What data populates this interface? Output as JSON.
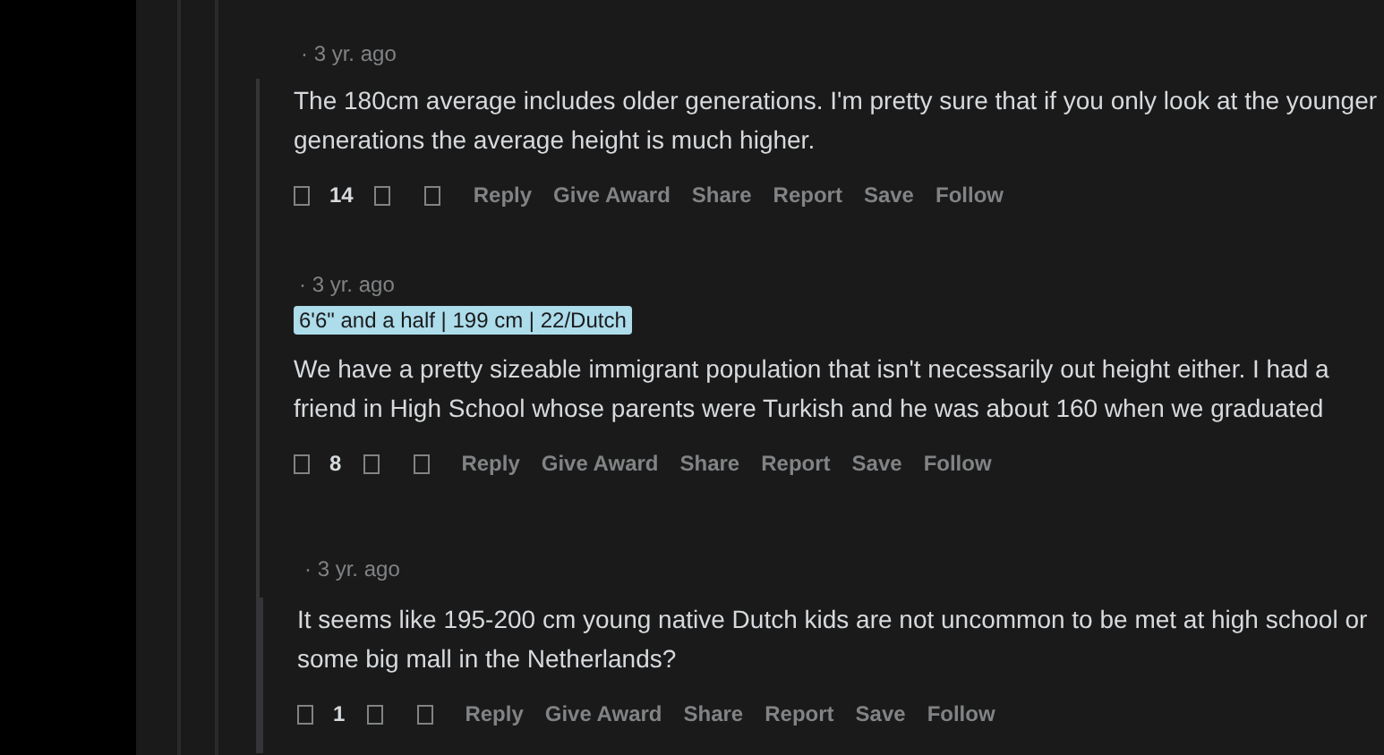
{
  "comments": [
    {
      "time": "· 3 yr. ago",
      "body": "The 180cm average includes older generations. I'm pretty sure that if you only look at the younger generations the average height is much higher.",
      "score": "14",
      "actions": [
        "Reply",
        "Give Award",
        "Share",
        "Report",
        "Save",
        "Follow"
      ],
      "children": [
        {
          "time": "· 3 yr. ago",
          "flair": "6'6\" and a half | 199 cm | 22/Dutch",
          "body": "We have a pretty sizeable immigrant population that isn't necessarily out height either. I had a friend in High School whose parents were Turkish and he was about 160 when we graduated",
          "score": "8",
          "actions": [
            "Reply",
            "Give Award",
            "Share",
            "Report",
            "Save",
            "Follow"
          ],
          "children": [
            {
              "time": "· 3 yr. ago",
              "body": "It seems like 195-200 cm young native Dutch kids are not uncommon to be met at high school or some big mall in the Netherlands?",
              "score": "1",
              "actions": [
                "Reply",
                "Give Award",
                "Share",
                "Report",
                "Save",
                "Follow"
              ]
            }
          ]
        }
      ]
    }
  ]
}
